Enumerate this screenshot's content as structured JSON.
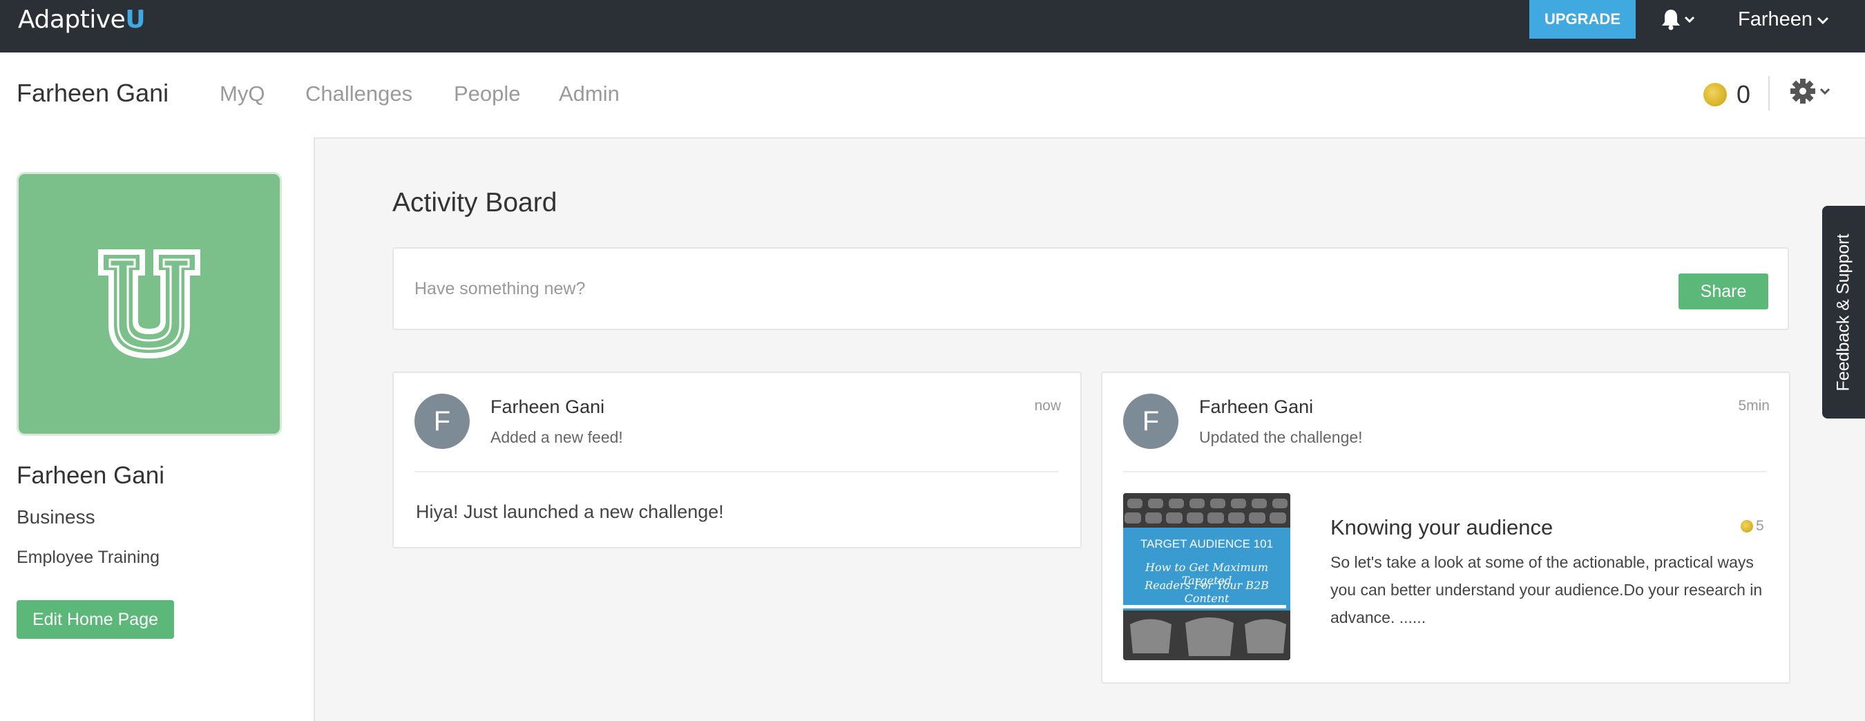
{
  "topbar": {
    "logo_text": "Adaptive",
    "logo_accent": "U",
    "upgrade_label": "UPGRADE",
    "user_label": "Farheen"
  },
  "subnav": {
    "user_name": "Farheen Gani",
    "links": [
      {
        "label": "MyQ"
      },
      {
        "label": "Challenges"
      },
      {
        "label": "People"
      },
      {
        "label": "Admin"
      }
    ],
    "coin_count": "0"
  },
  "sidebar": {
    "name": "Farheen Gani",
    "department": "Business",
    "subdepartment": "Employee Training",
    "edit_label": "Edit Home Page"
  },
  "main": {
    "title": "Activity Board",
    "composer_placeholder": "Have something new?",
    "share_label": "Share",
    "feeds": [
      {
        "avatar_initial": "F",
        "name": "Farheen Gani",
        "action": "Added a new feed!",
        "time": "now",
        "body": "Hiya! Just launched a new challenge!"
      },
      {
        "avatar_initial": "F",
        "name": "Farheen Gani",
        "action": "Updated the challenge!",
        "time": "5min",
        "challenge": {
          "thumb_line1": "TARGET AUDIENCE 101",
          "thumb_line2": "How to Get Maximum Targeted",
          "thumb_line3": "Readers For Your B2B Content",
          "title": "Knowing your audience",
          "points": "5",
          "description": "So let's take a look at some of the actionable, practical ways you can better understand your audience.Do your research in advance. ......"
        }
      }
    ]
  },
  "feedback_label": "Feedback & Support",
  "colors": {
    "topbar_bg": "#2b2f36",
    "accent_blue": "#3fa9e0",
    "green": "#5cb879",
    "avatar_green": "#7bbf8a",
    "coin_gold": "#d9b21f"
  },
  "icons": [
    "bell-icon",
    "chevron-down-icon",
    "coin-icon",
    "gear-icon",
    "university-u-logo"
  ]
}
